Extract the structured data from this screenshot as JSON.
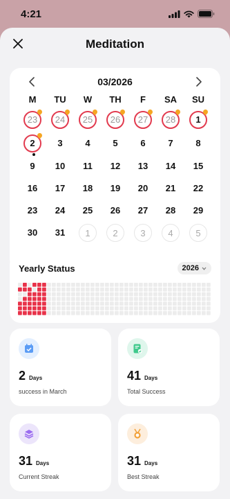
{
  "status_bar": {
    "time": "4:21"
  },
  "header": {
    "title": "Meditation"
  },
  "calendar": {
    "month_label": "03/2026",
    "weekdays": [
      "M",
      "TU",
      "W",
      "TH",
      "F",
      "SA",
      "SU"
    ],
    "weeks": [
      [
        {
          "d": "23",
          "other": true,
          "ring": true,
          "flame": true
        },
        {
          "d": "24",
          "other": true,
          "ring": true,
          "flame": true
        },
        {
          "d": "25",
          "other": true,
          "ring": true,
          "flame": true
        },
        {
          "d": "26",
          "other": true,
          "ring": true,
          "flame": true
        },
        {
          "d": "27",
          "other": true,
          "ring": true,
          "flame": true
        },
        {
          "d": "28",
          "other": true,
          "ring": true,
          "flame": true
        },
        {
          "d": "1",
          "ring": true,
          "flame": true
        }
      ],
      [
        {
          "d": "2",
          "ring": true,
          "flame": true,
          "dot": true
        },
        {
          "d": "3"
        },
        {
          "d": "4"
        },
        {
          "d": "5"
        },
        {
          "d": "6"
        },
        {
          "d": "7"
        },
        {
          "d": "8"
        }
      ],
      [
        {
          "d": "9"
        },
        {
          "d": "10"
        },
        {
          "d": "11"
        },
        {
          "d": "12"
        },
        {
          "d": "13"
        },
        {
          "d": "14"
        },
        {
          "d": "15"
        }
      ],
      [
        {
          "d": "16"
        },
        {
          "d": "17"
        },
        {
          "d": "18"
        },
        {
          "d": "19"
        },
        {
          "d": "20"
        },
        {
          "d": "21"
        },
        {
          "d": "22"
        }
      ],
      [
        {
          "d": "23"
        },
        {
          "d": "24"
        },
        {
          "d": "25"
        },
        {
          "d": "26"
        },
        {
          "d": "27"
        },
        {
          "d": "28"
        },
        {
          "d": "29"
        }
      ],
      [
        {
          "d": "30"
        },
        {
          "d": "31"
        },
        {
          "d": "1",
          "other": true
        },
        {
          "d": "2",
          "other": true
        },
        {
          "d": "3",
          "other": true
        },
        {
          "d": "4",
          "other": true
        },
        {
          "d": "5",
          "other": true
        }
      ]
    ]
  },
  "yearly": {
    "title": "Yearly Status",
    "year": "2026",
    "filled_cells": [
      [
        0,
        1
      ],
      [
        1,
        0
      ],
      [
        1,
        1
      ],
      [
        1,
        2
      ],
      [
        2,
        2
      ],
      [
        3,
        1
      ],
      [
        3,
        2
      ],
      [
        4,
        0
      ],
      [
        4,
        1
      ],
      [
        4,
        2
      ],
      [
        5,
        0
      ],
      [
        5,
        1
      ],
      [
        5,
        2
      ],
      [
        6,
        0
      ],
      [
        6,
        1
      ],
      [
        6,
        2
      ],
      [
        2,
        3
      ],
      [
        3,
        3
      ],
      [
        4,
        3
      ],
      [
        5,
        3
      ],
      [
        6,
        3
      ],
      [
        0,
        4
      ],
      [
        1,
        4
      ],
      [
        2,
        4
      ],
      [
        3,
        4
      ],
      [
        4,
        4
      ],
      [
        5,
        4
      ],
      [
        6,
        4
      ],
      [
        0,
        5
      ],
      [
        1,
        5
      ],
      [
        2,
        5
      ],
      [
        3,
        5
      ],
      [
        4,
        5
      ],
      [
        5,
        5
      ],
      [
        6,
        5
      ],
      [
        0,
        3
      ]
    ],
    "colors": {
      "filled": "#e8334a",
      "empty": "#ececec"
    }
  },
  "stats": [
    {
      "value": "2",
      "unit": "Days",
      "label": "success in March",
      "icon": "calendar-check-icon",
      "icon_bg": "#e3efff",
      "icon_color": "#5b9cf5"
    },
    {
      "value": "41",
      "unit": "Days",
      "label": "Total Success",
      "icon": "document-check-icon",
      "icon_bg": "#dff6ec",
      "icon_color": "#3fc98c"
    },
    {
      "value": "31",
      "unit": "Days",
      "label": "Current Streak",
      "icon": "layers-icon",
      "icon_bg": "#ece5fb",
      "icon_color": "#9b6cf0"
    },
    {
      "value": "31",
      "unit": "Days",
      "label": "Best Streak",
      "icon": "medal-icon",
      "icon_bg": "#fdeedd",
      "icon_color": "#f2a23b"
    }
  ]
}
